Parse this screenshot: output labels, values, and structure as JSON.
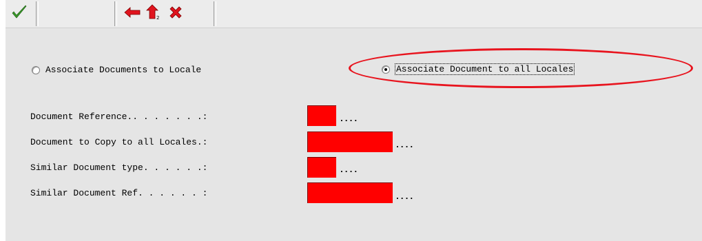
{
  "toolbar": {
    "buttons": [
      {
        "icon": "checkmark-icon",
        "color": "#3a9a2a"
      },
      {
        "icon": "back-arrow-icon",
        "color": "#e0141e"
      },
      {
        "icon": "exit-up-arrow-icon",
        "color": "#e0141e"
      },
      {
        "icon": "cancel-x-icon",
        "color": "#e0141e"
      }
    ]
  },
  "options": {
    "locale": {
      "label": "Associate Documents to Locale",
      "selected": false
    },
    "all_locales": {
      "label": "Associate Document to all Locales",
      "selected": true
    }
  },
  "fields": [
    {
      "label": "Document Reference.. . . . . . .:",
      "value": "",
      "dots": "...."
    },
    {
      "label": "Document to Copy to all Locales.:",
      "value": "",
      "dots": "...."
    },
    {
      "label": "Similar Document type. . . . . .:",
      "value": "",
      "dots": "...."
    },
    {
      "label": "Similar Document Ref. . . . . . :",
      "value": "",
      "dots": "...."
    }
  ],
  "colors": {
    "annotation_ellipse": "#e8141e",
    "required_field": "#ff0000",
    "panel_background": "#e5e5e5"
  }
}
